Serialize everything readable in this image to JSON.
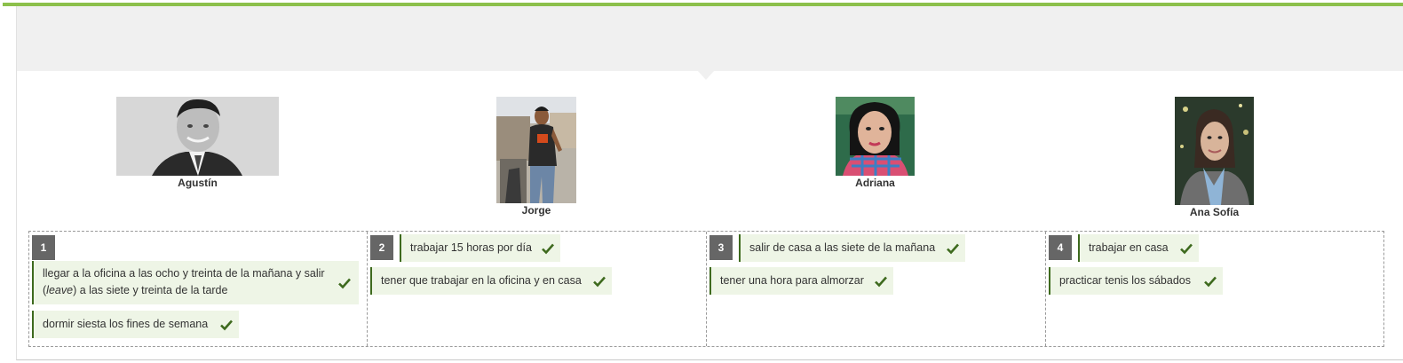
{
  "people": [
    {
      "name": "Agustín"
    },
    {
      "name": "Jorge"
    },
    {
      "name": "Adriana"
    },
    {
      "name": "Ana Sofía"
    }
  ],
  "columns": [
    {
      "number": "1",
      "items": [
        {
          "before": "llegar a la oficina a las ocho y treinta de la mañana y salir",
          "open": "(",
          "emphasis": "leave",
          "after": ") a las siete y treinta de la tarde"
        },
        {
          "text": "dormir siesta los fines de semana"
        }
      ]
    },
    {
      "number": "2",
      "items": [
        {
          "text": "trabajar 15 horas por día"
        },
        {
          "text": "tener que trabajar en la oficina y en casa"
        }
      ]
    },
    {
      "number": "3",
      "items": [
        {
          "text": "salir de casa a las siete de la mañana"
        },
        {
          "text": "tener una hora para almorzar"
        }
      ]
    },
    {
      "number": "4",
      "items": [
        {
          "text": "trabajar en casa"
        },
        {
          "text": "practicar tenis los sábados"
        }
      ]
    }
  ],
  "colors": {
    "accent": "#8cc04b",
    "chip_bg": "#eef5e6",
    "check": "#3e6a1e",
    "badge": "#666666"
  }
}
